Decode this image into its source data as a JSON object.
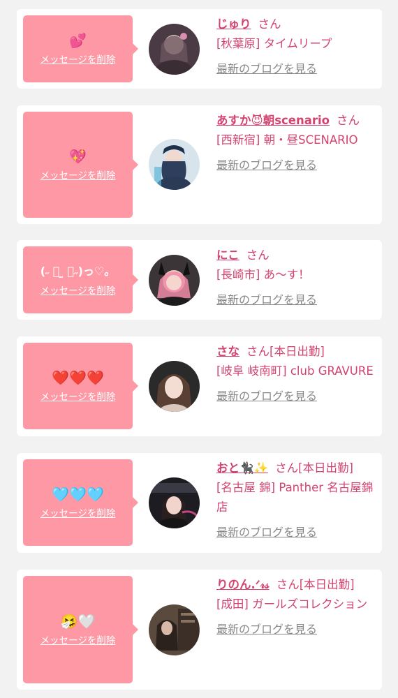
{
  "colors": {
    "background": "#f2f2f2",
    "card": "#ffffff",
    "bubble": "#fe98a4",
    "name_pink": "#d3436f",
    "link_gray": "#888888"
  },
  "delete_label": "メッセージを削除",
  "blog_label": "最新のブログを見る",
  "entries": [
    {
      "emoji": "💕",
      "name": "じゅり",
      "suffix": "さん",
      "shop": "[秋葉原] タイムリープ"
    },
    {
      "emoji": "💖",
      "name": "あすか😈朝scenario",
      "suffix": "さん",
      "shop": "[西新宿] 朝・昼SCENARIO"
    },
    {
      "emoji": "(˶ ॑ ̫ ॑˶)っ♡。",
      "name": "にこ",
      "suffix": "さん",
      "shop": "[長崎市] あ〜す！"
    },
    {
      "emoji": "❤️❤️❤️",
      "name": "さな",
      "suffix": "さん[本日出勤]",
      "shop": "[岐阜 岐南町] club GRAVURE"
    },
    {
      "emoji": "🩵🩵🩵",
      "name": "おと🐈‍⬛✨",
      "suffix": "さん[本日出勤]",
      "shop": "[名古屋 錦] Panther 名古屋錦店"
    },
    {
      "emoji": "🤧🤍",
      "name": "りのん.ᐟ𝓇𝓈",
      "suffix": "さん[本日出勤]",
      "shop": "[成田] ガールズコレクション"
    }
  ]
}
